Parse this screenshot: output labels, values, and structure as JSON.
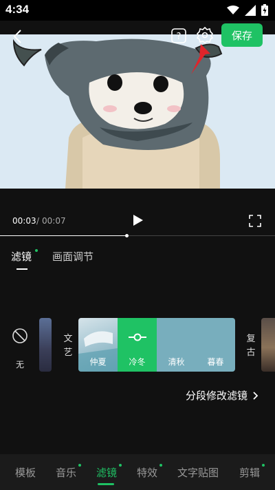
{
  "status_bar": {
    "time": "4:34",
    "icons": [
      "wifi-icon",
      "signal-icon",
      "battery-icon"
    ]
  },
  "header": {
    "back_icon": "chevron-left-icon",
    "help_icon": "question-icon",
    "settings_icon": "gear-icon",
    "save_label": "保存"
  },
  "playback": {
    "current_time": "00:03",
    "separator": "/",
    "total_time": "00:07",
    "progress": 0.46
  },
  "sub_tabs": {
    "filter": "滤镜",
    "adjust": "画面调节"
  },
  "filters": {
    "none_label": "无",
    "category_left": "文艺",
    "category_right": "复古",
    "items": [
      {
        "label": "仲夏"
      },
      {
        "label": "冷冬"
      },
      {
        "label": "清秋"
      },
      {
        "label": "暮春"
      }
    ],
    "selected_index": 1
  },
  "segment_link": "分段修改滤镜",
  "bottom_nav": {
    "items": [
      "模板",
      "音乐",
      "滤镜",
      "特效",
      "文字贴图",
      "剪辑"
    ],
    "active_index": 2
  },
  "colors": {
    "accent": "#1fc264",
    "background": "#111111"
  }
}
